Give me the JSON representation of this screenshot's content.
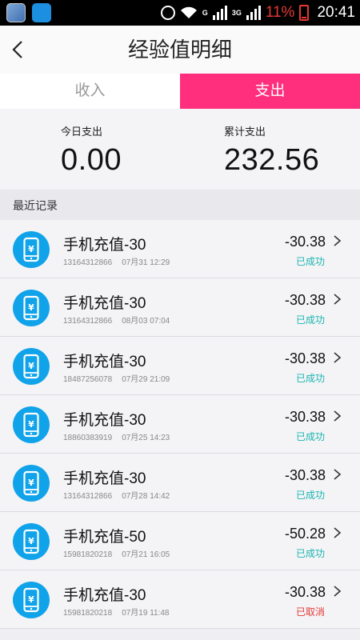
{
  "status_bar": {
    "network": "G",
    "network2": "3G",
    "battery": "11%",
    "time": "20:41"
  },
  "header": {
    "title": "经验值明细"
  },
  "tabs": [
    {
      "label": "收入",
      "active": false
    },
    {
      "label": "支出",
      "active": true
    }
  ],
  "summary": {
    "today_label": "今日支出",
    "today_value": "0.00",
    "total_label": "累计支出",
    "total_value": "232.56"
  },
  "section": {
    "title": "最近记录"
  },
  "colors": {
    "accent": "#ff2f7d",
    "icon_bg": "#11a3ea",
    "success": "#19b5b0",
    "cancelled": "#e53935"
  },
  "records": [
    {
      "title": "手机充值-30",
      "phone": "13164312866",
      "datetime": "07月31 12:29",
      "amount": "-30.38",
      "status": "已成功",
      "status_type": "success"
    },
    {
      "title": "手机充值-30",
      "phone": "13164312866",
      "datetime": "08月03 07:04",
      "amount": "-30.38",
      "status": "已成功",
      "status_type": "success"
    },
    {
      "title": "手机充值-30",
      "phone": "18487256078",
      "datetime": "07月29 21:09",
      "amount": "-30.38",
      "status": "已成功",
      "status_type": "success"
    },
    {
      "title": "手机充值-30",
      "phone": "18860383919",
      "datetime": "07月25 14:23",
      "amount": "-30.38",
      "status": "已成功",
      "status_type": "success"
    },
    {
      "title": "手机充值-30",
      "phone": "13164312866",
      "datetime": "07月28 14:42",
      "amount": "-30.38",
      "status": "已成功",
      "status_type": "success"
    },
    {
      "title": "手机充值-50",
      "phone": "15981820218",
      "datetime": "07月21 16:05",
      "amount": "-50.28",
      "status": "已成功",
      "status_type": "success"
    },
    {
      "title": "手机充值-30",
      "phone": "15981820218",
      "datetime": "07月19 11:48",
      "amount": "-30.38",
      "status": "已取消",
      "status_type": "cancelled"
    }
  ]
}
